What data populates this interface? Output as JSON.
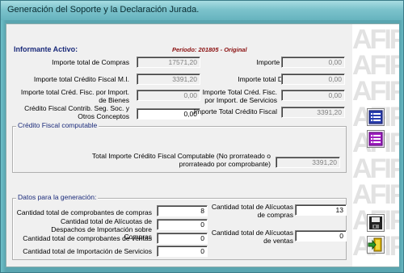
{
  "window": {
    "title": "Generación del Soporte y la Declaración Jurada."
  },
  "header": {
    "informante": "Informante Activo:",
    "periodo": "Período: 201805 - Original"
  },
  "left_fields": [
    {
      "label": "Importe total de Compras",
      "value": "17571,20"
    },
    {
      "label": "Importe total Crédito Fiscal M.I.",
      "value": "3391,20"
    },
    {
      "label": "Importe total Créd. Fisc. por Import. de Bienes",
      "value": "0,00"
    },
    {
      "label": "Crédito Fiscal Contrib. Seg. Soc. y Otros Conceptos",
      "value": "0,00"
    }
  ],
  "right_fields": [
    {
      "label": "Importe total Ventas",
      "value": "0,00"
    },
    {
      "label": "Importe total Débito Fiscal",
      "value": "0,00"
    },
    {
      "label": "Importe Total Créd. Fisc. por Import. de Servicios",
      "value": "0,00"
    },
    {
      "label": "Importe Total Crédito Fiscal",
      "value": "3391,20"
    }
  ],
  "computable": {
    "title": "Crédito Fiscal computable",
    "label": "Total Importe Crédito Fiscal Computable (No prorrateado o prorrateado por comprobante)",
    "value": "3391,20"
  },
  "generacion": {
    "title": "Datos para la generación:",
    "left": [
      {
        "label": "Cantidad total de comprobantes de compras",
        "value": "8"
      },
      {
        "label": "Cantidad total de Alícuotas de Despachos de Importación sobre Compras",
        "value": "0"
      },
      {
        "label": "Cantidad total de comprobantes de ventas",
        "value": "0"
      },
      {
        "label": "Cantidad total de Importación de Servicios",
        "value": "0"
      }
    ],
    "right": [
      {
        "label": "Cantidad total de Alícuotas de compras",
        "value": "13"
      },
      {
        "label": "Cantidad total de Alícuotas de ventas",
        "value": "0"
      }
    ]
  },
  "watermark": "AFIP",
  "colors": {
    "accent": "#1a2a7a",
    "period": "#8b1010",
    "titlebar": "#7cc3cc"
  },
  "toolbar": {
    "icons": [
      "list-blue-icon",
      "list-purple-icon",
      "save-icon",
      "exit-icon"
    ]
  }
}
